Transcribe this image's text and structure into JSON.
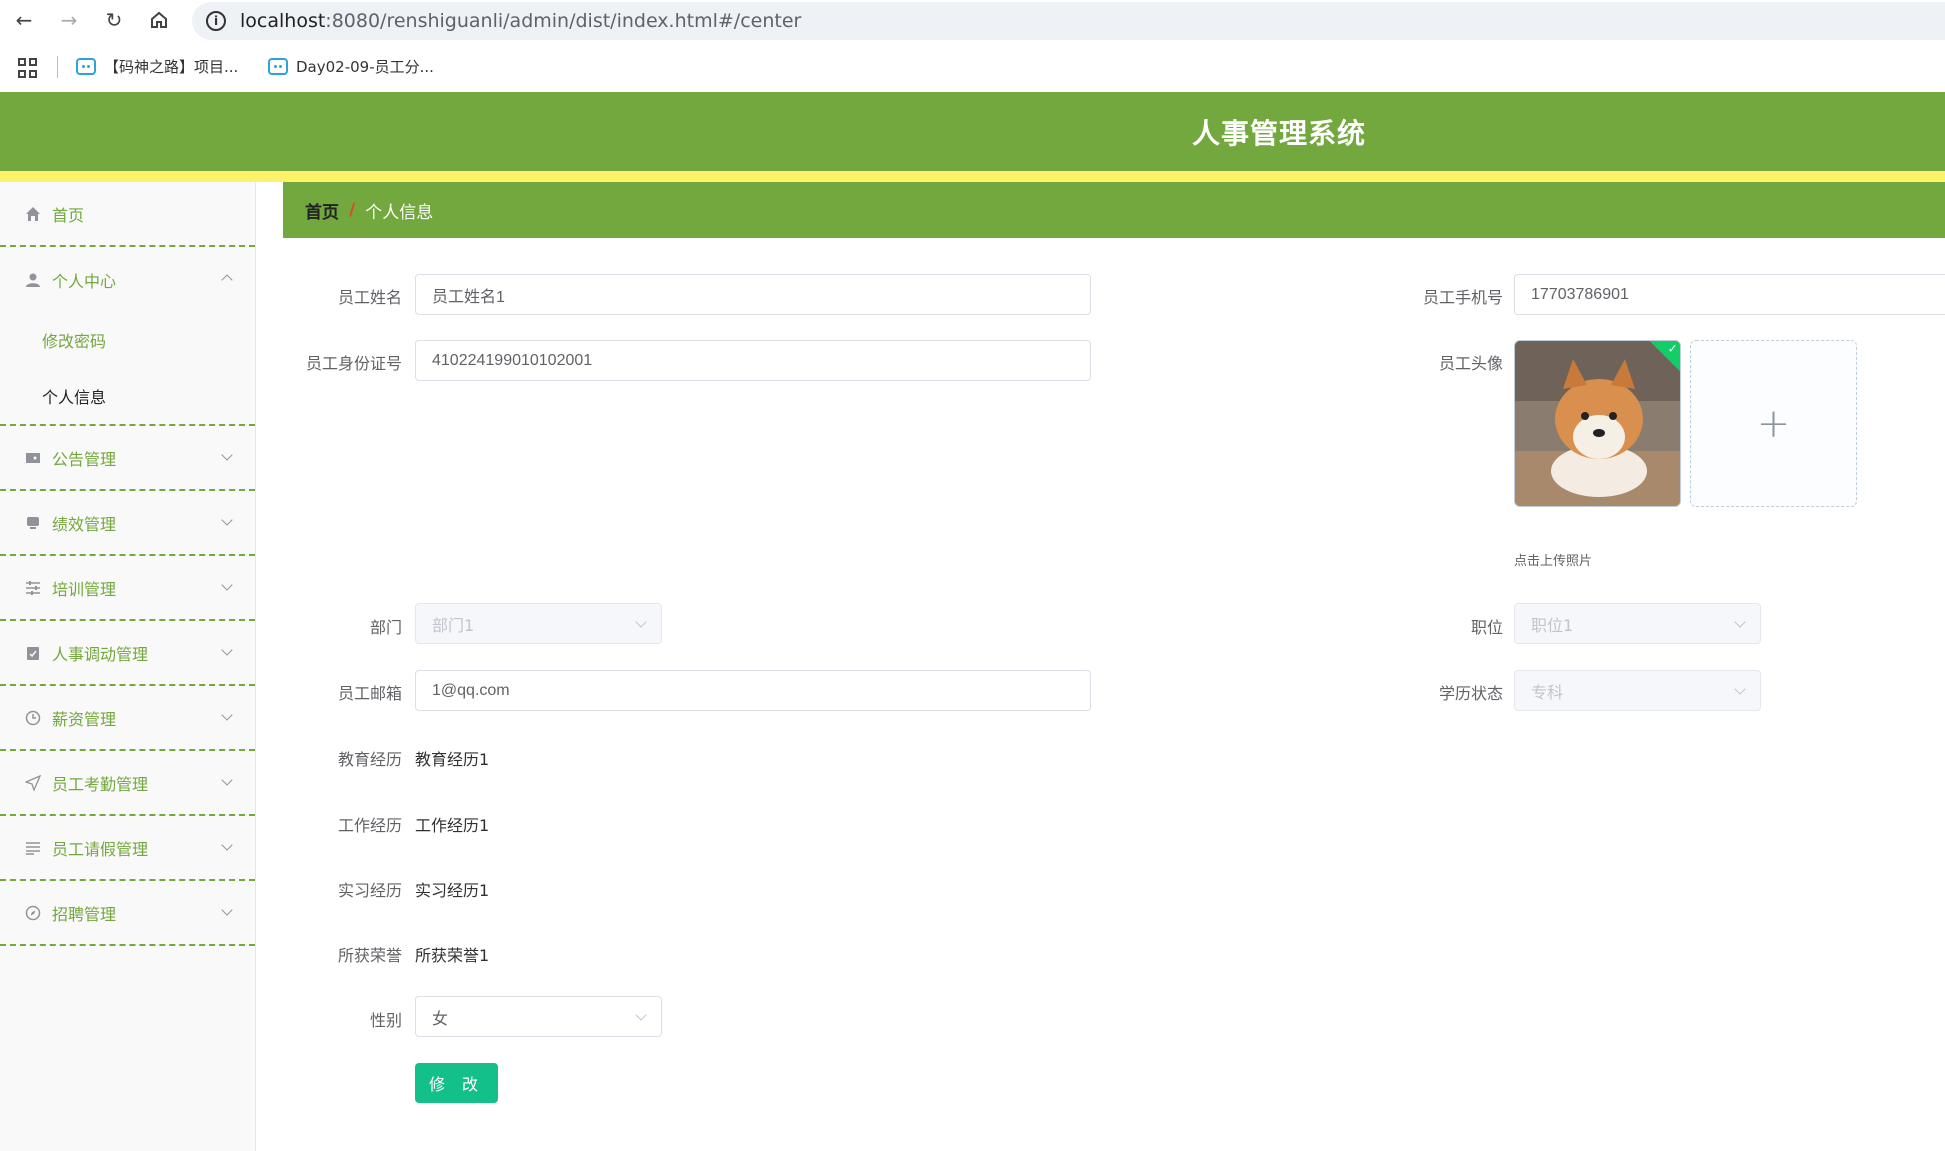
{
  "browser": {
    "url_host": "localhost",
    "url_rest": ":8080/renshiguanli/admin/dist/index.html#/center",
    "bookmarks": [
      "【码神之路】项目...",
      "Day02-09-员工分..."
    ]
  },
  "app": {
    "title": "人事管理系统",
    "colors": {
      "primary": "#72a83e",
      "stripe": "#fdf36a",
      "button": "#13c08a"
    }
  },
  "sidebar": {
    "items": [
      {
        "label": "首页",
        "icon": "home-icon"
      },
      {
        "label": "个人中心",
        "icon": "user-icon"
      },
      {
        "label": "公告管理",
        "icon": "ticket-icon"
      },
      {
        "label": "绩效管理",
        "icon": "monitor-icon"
      },
      {
        "label": "培训管理",
        "icon": "sliders-icon"
      },
      {
        "label": "人事调动管理",
        "icon": "clipboard-check-icon"
      },
      {
        "label": "薪资管理",
        "icon": "clock-icon"
      },
      {
        "label": "员工考勤管理",
        "icon": "send-icon"
      },
      {
        "label": "员工请假管理",
        "icon": "list-icon"
      },
      {
        "label": "招聘管理",
        "icon": "compass-icon"
      }
    ],
    "submenu": {
      "change_password": "修改密码",
      "profile": "个人信息"
    }
  },
  "breadcrumb": {
    "home": "首页",
    "separator": "/",
    "current": "个人信息"
  },
  "form": {
    "name": {
      "label": "员工姓名",
      "value": "员工姓名1"
    },
    "phone": {
      "label": "员工手机号",
      "value": "17703786901"
    },
    "id_number": {
      "label": "员工身份证号",
      "value": "410224199010102001"
    },
    "avatar": {
      "label": "员工头像",
      "tip": "点击上传照片"
    },
    "department": {
      "label": "部门",
      "value": "部门1"
    },
    "position": {
      "label": "职位",
      "value": "职位1"
    },
    "email": {
      "label": "员工邮箱",
      "value": "1@qq.com"
    },
    "education_status": {
      "label": "学历状态",
      "value": "专科"
    },
    "education": {
      "label": "教育经历",
      "value": "教育经历1"
    },
    "work": {
      "label": "工作经历",
      "value": "工作经历1"
    },
    "internship": {
      "label": "实习经历",
      "value": "实习经历1"
    },
    "honors": {
      "label": "所获荣誉",
      "value": "所获荣誉1"
    },
    "gender": {
      "label": "性别",
      "value": "女"
    },
    "submit_label": "修 改"
  }
}
